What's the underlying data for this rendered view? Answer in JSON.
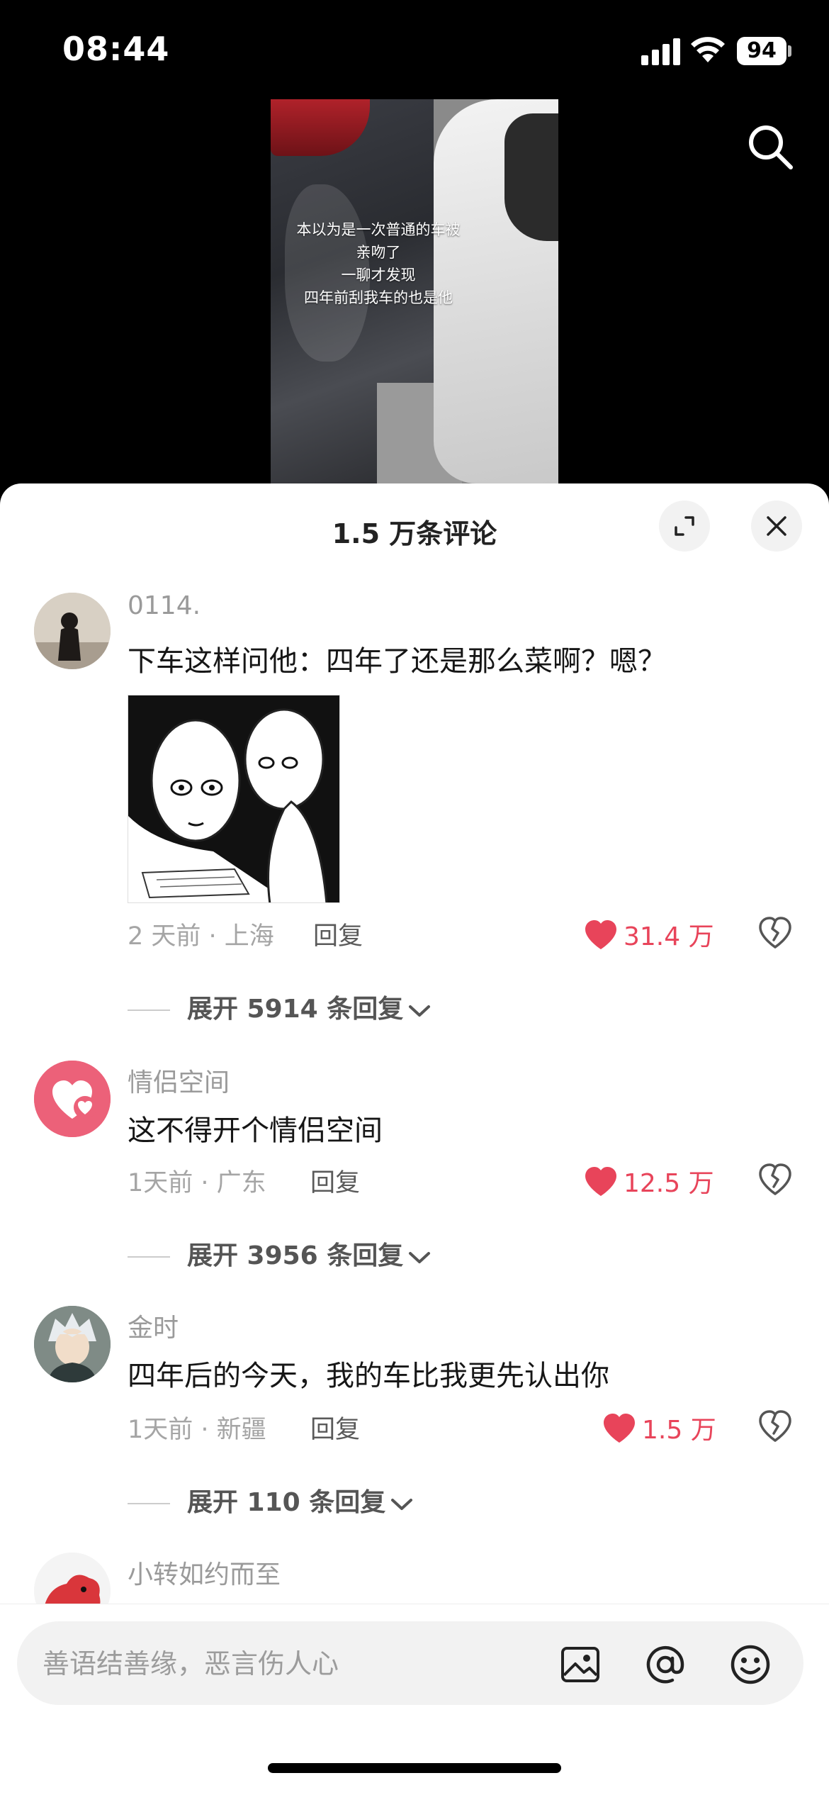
{
  "status_bar": {
    "time": "08:44",
    "battery": "94"
  },
  "video": {
    "caption_lines": [
      "本以为是一次普通的车被",
      "亲吻了",
      "一聊才发现",
      "四年前刮我车的也是他"
    ]
  },
  "icons": {
    "search": "search-icon",
    "expand": "expand-icon",
    "close": "close-icon",
    "like": "heart-icon",
    "dislike": "broken-heart-icon",
    "image": "image-icon",
    "mention": "at-icon",
    "emoji": "emoji-icon"
  },
  "colors": {
    "like": "#e8445a",
    "sheet_bg": "#ffffff",
    "input_bg": "#f2f2f2"
  },
  "comments_panel": {
    "title": "1.5 万条评论",
    "comments": [
      {
        "username": "0114.",
        "text": "下车这样问他：四年了还是那么菜啊？嗯？",
        "meta": "2 天前 · 上海",
        "reply_label": "回复",
        "likes": "31.4 万",
        "expand_label": "展开 5914 条回复"
      },
      {
        "username": "情侣空间",
        "text": "这不得开个情侣空间",
        "meta": "1天前 · 广东",
        "reply_label": "回复",
        "likes": "12.5 万",
        "expand_label": "展开 3956 条回复"
      },
      {
        "username": "金时",
        "text": "四年后的今天，我的车比我更先认出你",
        "meta": "1天前 · 新疆",
        "reply_label": "回复",
        "likes": "1.5 万",
        "expand_label": "展开 110 条回复"
      },
      {
        "username": "小转如约而至"
      }
    ]
  },
  "input": {
    "placeholder": "善语结善缘，恶言伤人心"
  }
}
